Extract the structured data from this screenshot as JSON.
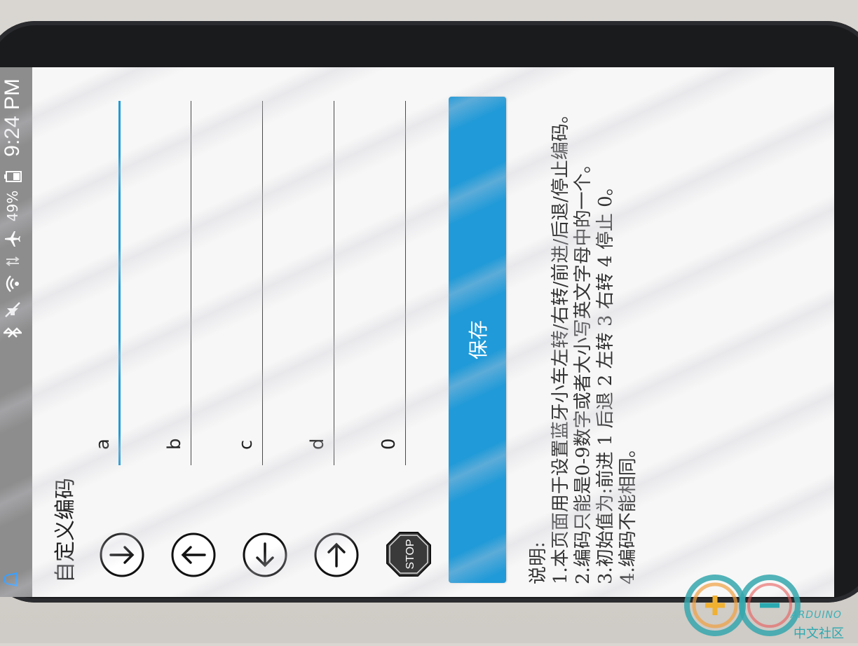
{
  "status_bar": {
    "battery_percent": "49%",
    "time": "9:24 PM"
  },
  "page": {
    "title": "自定义编码"
  },
  "commands": [
    {
      "icon": "arrow-down-icon",
      "value": "a"
    },
    {
      "icon": "arrow-up-icon",
      "value": "b"
    },
    {
      "icon": "arrow-left-icon",
      "value": "c"
    },
    {
      "icon": "arrow-right-icon",
      "value": "d"
    },
    {
      "icon": "stop-sign-icon",
      "value": "0",
      "icon_label": "STOP"
    }
  ],
  "save_button": {
    "label": "保存"
  },
  "notes": {
    "heading": "说明:",
    "lines": [
      "1.本页面用于设置蓝牙小车左转/右转/前进/后退/停止编码。",
      "2.编码只能是0-9数字或者大小写英文字母中的一个。",
      "3.初始值为:前进 1 后退 2 左转 3 右转 4 停止 0。",
      "4.编码不能相同。"
    ]
  },
  "watermark": {
    "brand": "ARDUINO",
    "subtitle": "中文社区"
  },
  "colors": {
    "accent": "#209ad8",
    "status_bar": "#8d8d8d",
    "stop_sign": "#3a3a3a"
  }
}
